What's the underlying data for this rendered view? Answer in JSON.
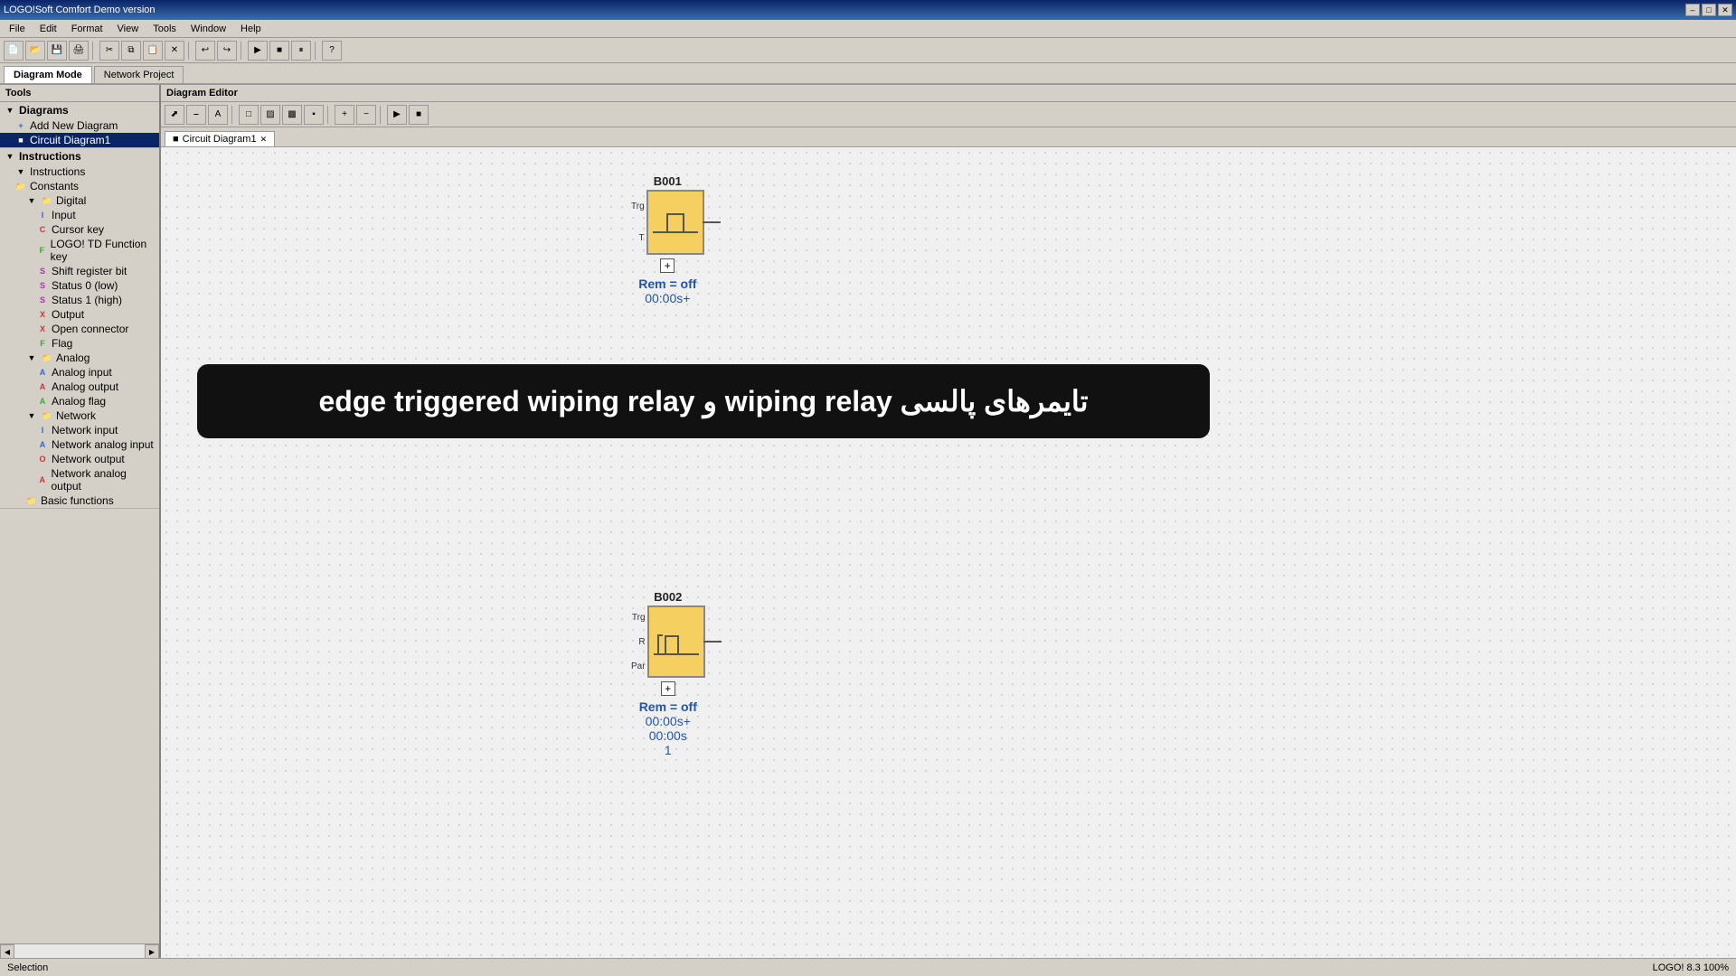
{
  "app": {
    "title": "LOGOSoft Comfort Demo version",
    "logo": "LOGO!Soft Comfort Demo version"
  },
  "menu": {
    "items": [
      "File",
      "Edit",
      "Format",
      "View",
      "Tools",
      "Window",
      "Help"
    ]
  },
  "mode_tabs": {
    "diagram_mode": "Diagram Mode",
    "network_project": "Network Project"
  },
  "left_panel": {
    "title": "Tools",
    "diagrams_section": "Diagrams",
    "add_new_diagram": "Add New Diagram",
    "circuit_diagram": "Circuit Diagram1",
    "instructions_section": "Instructions",
    "instructions_sub": "Instructions",
    "constants_section": "Constants",
    "digital_folder": "Digital",
    "digital_items": [
      {
        "label": "Input",
        "icon": "I"
      },
      {
        "label": "Cursor key",
        "icon": "C"
      },
      {
        "label": "LOGO! TD Function key",
        "icon": "F"
      },
      {
        "label": "Shift register bit",
        "icon": "S"
      },
      {
        "label": "Status 0 (low)",
        "icon": "S"
      },
      {
        "label": "Status 1 (high)",
        "icon": "S"
      },
      {
        "label": "Output",
        "icon": "O"
      },
      {
        "label": "Open connector",
        "icon": "X"
      },
      {
        "label": "Flag",
        "icon": "F"
      }
    ],
    "analog_folder": "Analog",
    "analog_items": [
      {
        "label": "Analog input",
        "icon": "A"
      },
      {
        "label": "Analog output",
        "icon": "A"
      },
      {
        "label": "Analog flag",
        "icon": "A"
      }
    ],
    "network_folder": "Network",
    "network_items": [
      {
        "label": "Network input",
        "icon": "I"
      },
      {
        "label": "Network analog input",
        "icon": "A"
      },
      {
        "label": "Network output",
        "icon": "O"
      },
      {
        "label": "Network analog output",
        "icon": "A"
      }
    ],
    "basic_functions": "Basic functions"
  },
  "diagram_editor": {
    "title": "Diagram Editor",
    "tab_name": "Circuit Diagram1"
  },
  "block_b001": {
    "id": "B001",
    "trg_pin": "Trg",
    "t_pin": "T",
    "rem_label": "Rem = off",
    "time_label": "00:00s+"
  },
  "block_b002": {
    "id": "B002",
    "trg_pin": "Trg",
    "r_pin": "R",
    "par_pin": "Par",
    "rem_label": "Rem = off",
    "time1_label": "00:00s+",
    "time2_label": "00:00s",
    "value_label": "1"
  },
  "banner": {
    "text_rtl": "تایمرهای پالسی wiping relay و",
    "text_ltr": "edge triggered wiping relay",
    "text_and": "و",
    "full_text": "تایمرهای پالسی wiping relay و edge triggered wiping relay"
  },
  "status_bar": {
    "left": "Selection",
    "right": "LOGO! 8.3 100%"
  }
}
